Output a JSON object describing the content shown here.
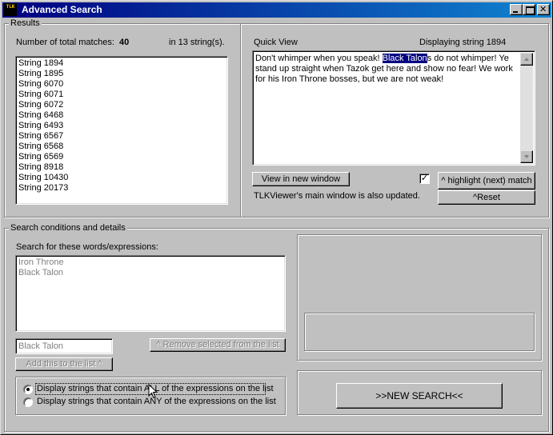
{
  "window": {
    "title": "Advanced Search",
    "icon_text": "TLK"
  },
  "results": {
    "group_label": "Results",
    "total_matches_label": "Number of total matches:",
    "total_matches": "40",
    "strings_count_text": "in 13 string(s).",
    "strings": [
      "String 1894",
      "String 1895",
      "String 6070",
      "String 6071",
      "String 6072",
      "String 6468",
      "String 6493",
      "String 6567",
      "String 6568",
      "String 6569",
      "String 8918",
      "String 10430",
      "String 20173"
    ]
  },
  "quick_view": {
    "label": "Quick View",
    "displaying": "Displaying string 1894",
    "text_before": "Don't whimper when you speak!  ",
    "text_highlight": "Black Talon",
    "text_after": "s do not whimper!  Ye stand up straight when Tazok get here and show no fear!  We work for his Iron Throne bosses, but we are not weak!",
    "view_new_window_button": "View in new window",
    "highlight_button": "^ highlight (next) match",
    "reset_button": "^Reset",
    "checkbox_checked": true,
    "checkbox_mark": "✓",
    "status_text": "TLKViewer's main window is also updated."
  },
  "search": {
    "group_label": "Search conditions and details",
    "expressions_label": "Search for these words/expressions:",
    "expressions": [
      "Iron Throne",
      "Black Talon"
    ],
    "input_value": "Black Talon",
    "remove_button": "^ Remove selected from the list",
    "add_button": "Add this to the list ^",
    "option_all": "Display strings that contain ALL of the expressions on the list",
    "option_any": "Display strings that contain ANY of the expressions on the list",
    "selected_option": "all",
    "new_search_button": ">>NEW SEARCH<<"
  }
}
